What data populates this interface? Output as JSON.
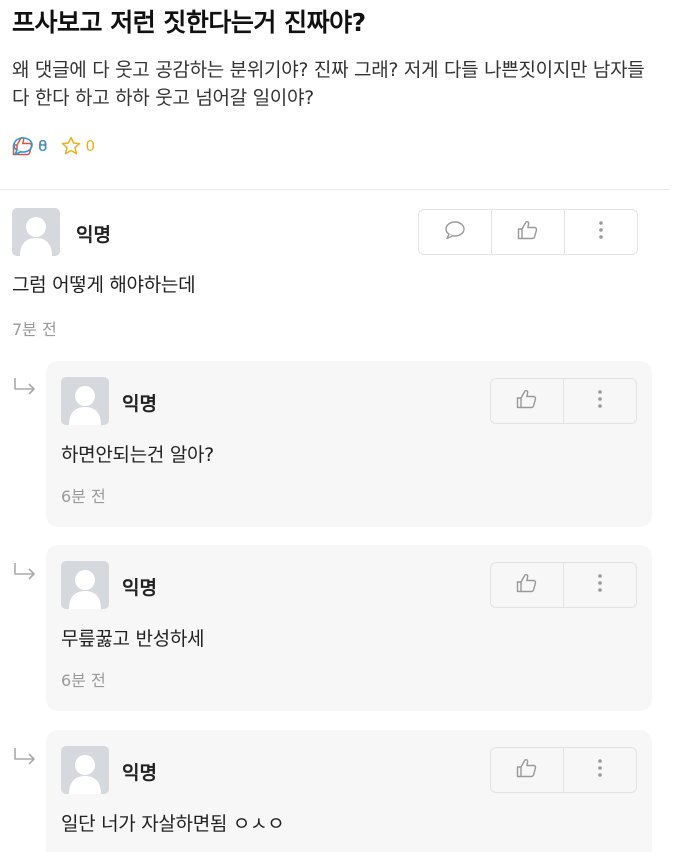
{
  "post": {
    "title": "프사보고 저런 짓한다는거 진짜야?",
    "body": "왜 댓글에 다 웃고 공감하는 분위기야? 진짜 그래? 저게 다들 나쁜짓이지만 남자들 다 한다 하고 하하 웃고 넘어갈 일이야?",
    "stats": {
      "likes": "0",
      "comments": "8",
      "scraps": "0"
    }
  },
  "colors": {
    "like": "#e0533b",
    "comment": "#2a9bd6",
    "scrap": "#e8b21c",
    "reply_bg": "#f7f7f7"
  },
  "icons": {
    "like": "thumbs-up-icon",
    "comment": "speech-bubble-icon",
    "scrap": "star-icon",
    "more": "more-vertical-icon",
    "reply": "reply-arrow-icon",
    "avatar": "default-avatar-icon"
  },
  "comments": [
    {
      "author": "익명",
      "text": "그럼 어떻게 해야하는데",
      "time": "7분 전"
    }
  ],
  "replies": [
    {
      "author": "익명",
      "text": "하면안되는건 알아?",
      "time": "6분 전"
    },
    {
      "author": "익명",
      "text": "무릎꿇고 반성하세",
      "time": "6분 전"
    },
    {
      "author": "익명",
      "text": "일단 너가 자살하면됨 ㅇㅅㅇ",
      "time": ""
    }
  ]
}
